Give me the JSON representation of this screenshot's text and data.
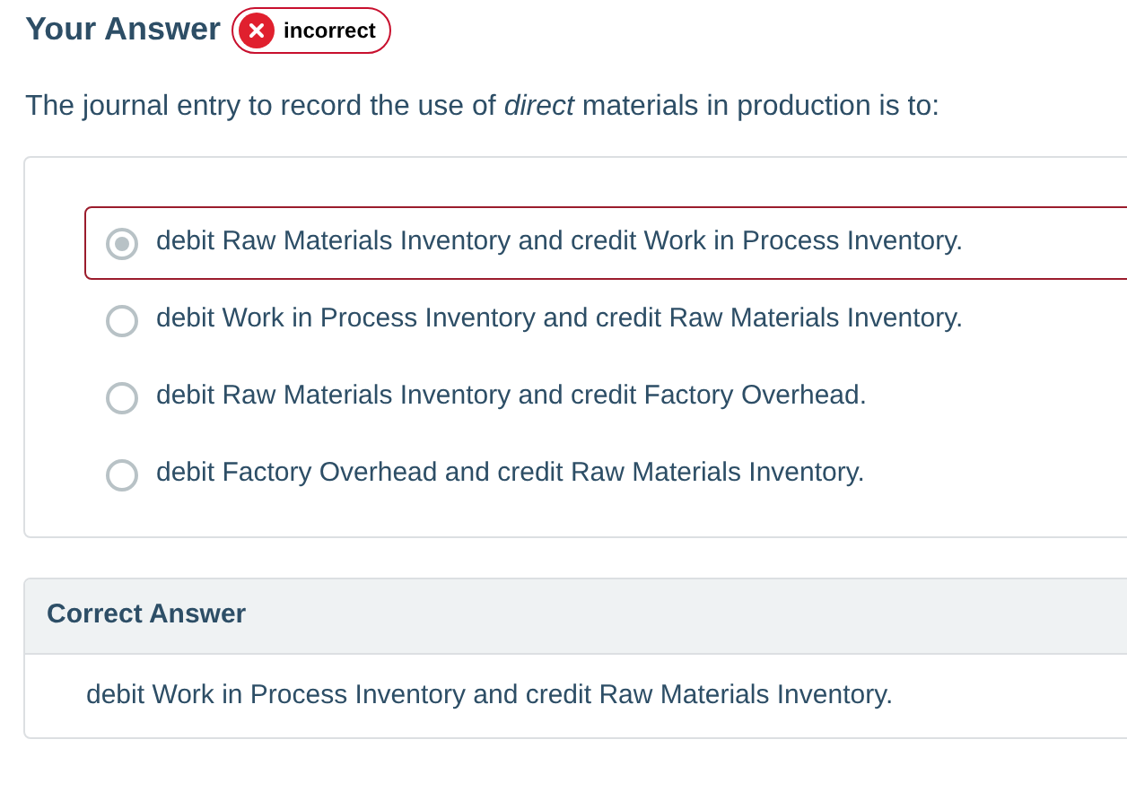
{
  "heading": "Your Answer",
  "badge": {
    "kind": "incorrect",
    "label": "incorrect"
  },
  "question": "The journal entry to record the use of *direct* materials in production is to:",
  "options": [
    {
      "label": "debit Raw Materials Inventory and credit Work in Process Inventory.",
      "selected": true
    },
    {
      "label": "debit Work in Process Inventory and credit Raw Materials Inventory.",
      "selected": false
    },
    {
      "label": "debit Raw Materials Inventory and credit Factory Overhead.",
      "selected": false
    },
    {
      "label": "debit Factory Overhead and credit Raw Materials Inventory.",
      "selected": false
    }
  ],
  "correct_answer": {
    "title": "Correct Answer",
    "text": "debit Work in Process Inventory and credit Raw Materials Inventory."
  }
}
